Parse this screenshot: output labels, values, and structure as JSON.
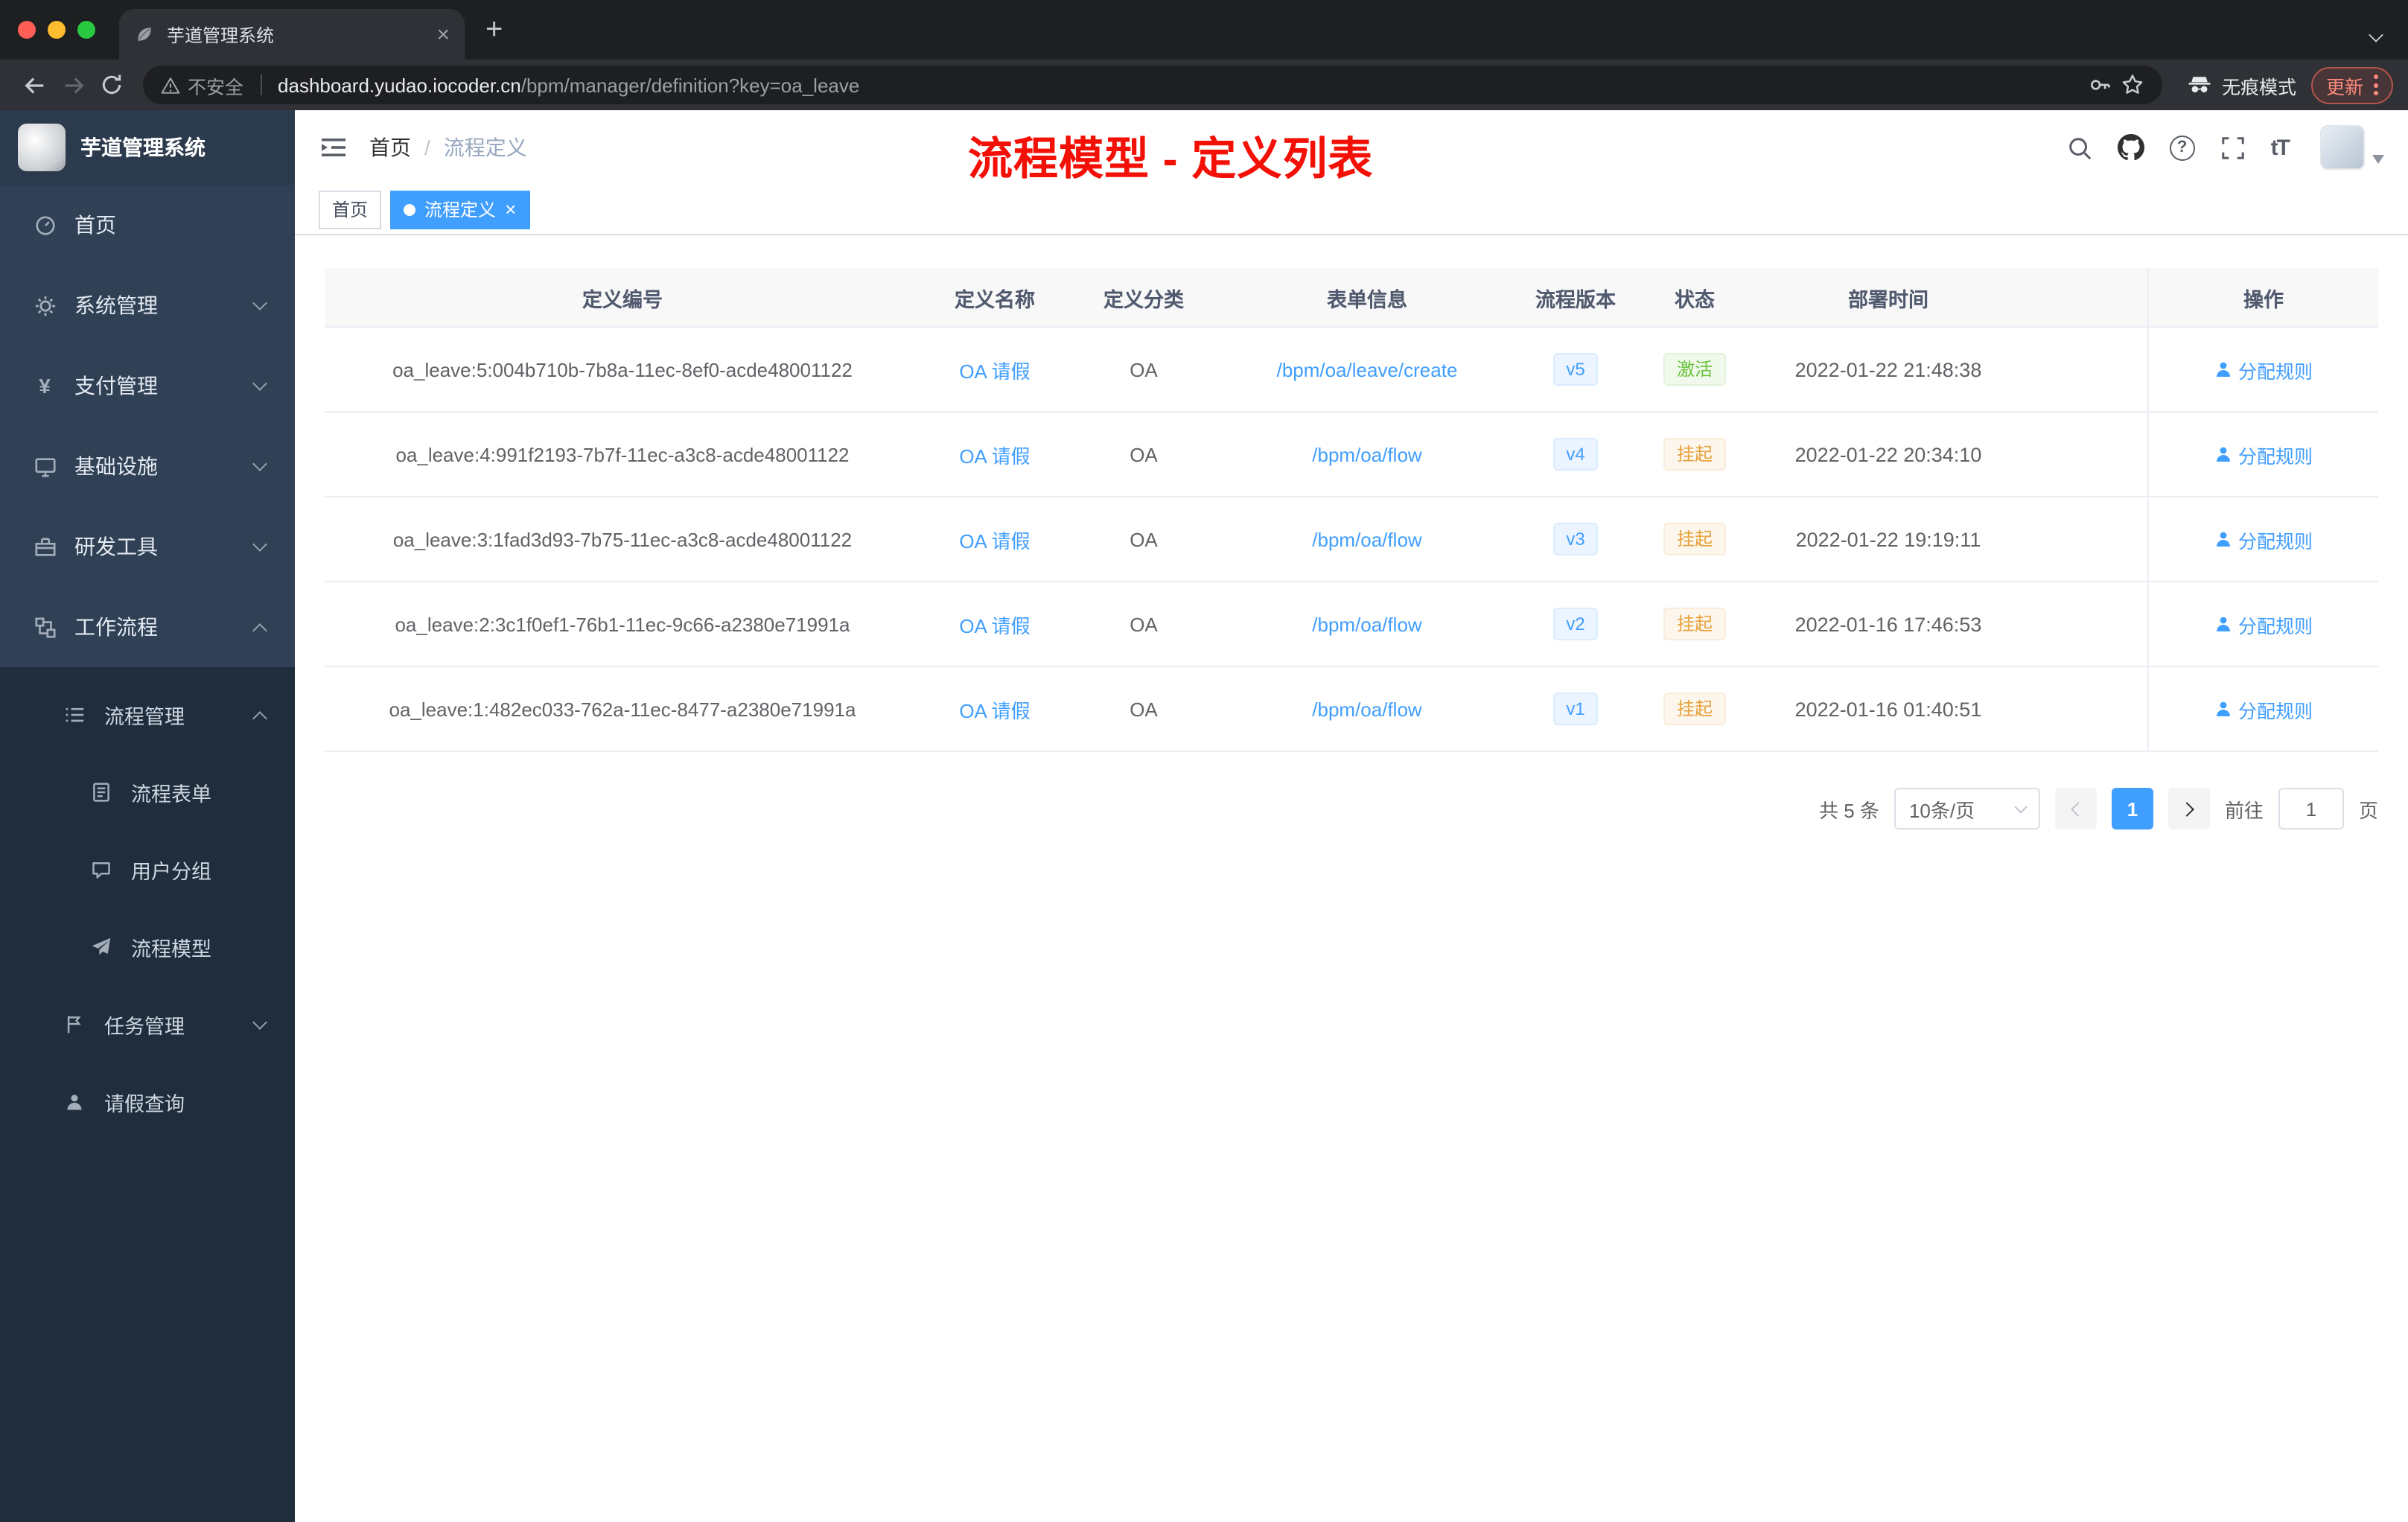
{
  "browser": {
    "tab_title": "芋道管理系统",
    "toolbar": {
      "security_label": "不安全",
      "url_host": "dashboard.yudao.iocoder.cn",
      "url_path": "/bpm/manager/definition?key=oa_leave",
      "incognito_label": "无痕模式",
      "update_label": "更新"
    }
  },
  "sidebar": {
    "logo_title": "芋道管理系统",
    "items": [
      {
        "label": "首页"
      },
      {
        "label": "系统管理"
      },
      {
        "label": "支付管理"
      },
      {
        "label": "基础设施"
      },
      {
        "label": "研发工具"
      },
      {
        "label": "工作流程"
      }
    ],
    "sub_items": [
      {
        "label": "流程管理"
      },
      {
        "label": "流程表单"
      },
      {
        "label": "用户分组"
      },
      {
        "label": "流程模型"
      },
      {
        "label": "任务管理"
      },
      {
        "label": "请假查询"
      }
    ]
  },
  "header": {
    "breadcrumb_home": "首页",
    "breadcrumb_current": "流程定义",
    "annotation": "流程模型 - 定义列表"
  },
  "tags": {
    "home": "首页",
    "active": "流程定义"
  },
  "table": {
    "headers": [
      "定义编号",
      "定义名称",
      "定义分类",
      "表单信息",
      "流程版本",
      "状态",
      "部署时间",
      "操作"
    ],
    "rows": [
      {
        "id": "oa_leave:5:004b710b-7b8a-11ec-8ef0-acde48001122",
        "name": "OA 请假",
        "category": "OA",
        "form": "/bpm/oa/leave/create",
        "version": "v5",
        "status": "激活",
        "time": "2022-01-22 21:48:38",
        "action": "分配规则"
      },
      {
        "id": "oa_leave:4:991f2193-7b7f-11ec-a3c8-acde48001122",
        "name": "OA 请假",
        "category": "OA",
        "form": "/bpm/oa/flow",
        "version": "v4",
        "status": "挂起",
        "time": "2022-01-22 20:34:10",
        "action": "分配规则"
      },
      {
        "id": "oa_leave:3:1fad3d93-7b75-11ec-a3c8-acde48001122",
        "name": "OA 请假",
        "category": "OA",
        "form": "/bpm/oa/flow",
        "version": "v3",
        "status": "挂起",
        "time": "2022-01-22 19:19:11",
        "action": "分配规则"
      },
      {
        "id": "oa_leave:2:3c1f0ef1-76b1-11ec-9c66-a2380e71991a",
        "name": "OA 请假",
        "category": "OA",
        "form": "/bpm/oa/flow",
        "version": "v2",
        "status": "挂起",
        "time": "2022-01-16 17:46:53",
        "action": "分配规则"
      },
      {
        "id": "oa_leave:1:482ec033-762a-11ec-8477-a2380e71991a",
        "name": "OA 请假",
        "category": "OA",
        "form": "/bpm/oa/flow",
        "version": "v1",
        "status": "挂起",
        "time": "2022-01-16 01:40:51",
        "action": "分配规则"
      }
    ]
  },
  "pagination": {
    "total": "共 5 条",
    "page_size": "10条/页",
    "current_page": "1",
    "goto_label": "前往",
    "goto_value": "1",
    "goto_unit": "页"
  },
  "colors": {
    "accent_blue": "#409eff",
    "success_green": "#67c23a",
    "warning_orange": "#e6a23c",
    "annotation_red": "#f31006",
    "sidebar_bg": "#304156",
    "submenu_bg": "#1f2d3d"
  }
}
